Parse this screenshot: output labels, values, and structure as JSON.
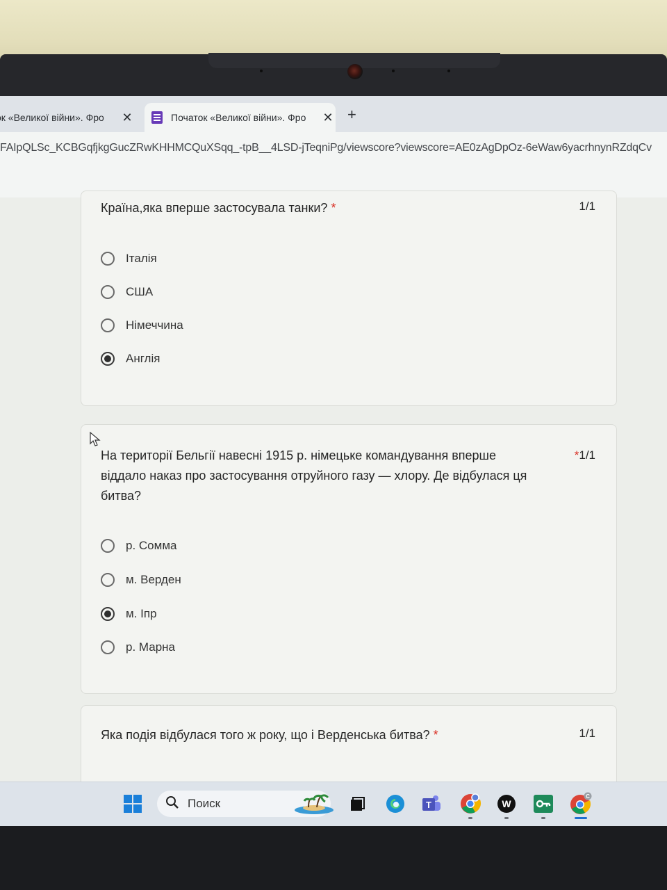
{
  "browser": {
    "tabs": [
      {
        "title": "ок «Великої війни». Фро",
        "active": false
      },
      {
        "title": "Початок «Великої війни». Фро",
        "active": true
      }
    ],
    "close_glyph": "✕",
    "new_tab_glyph": "+",
    "url": "FAIpQLSc_KCBGqfjkgGucZRwKHHMCQuXSqq_-tpB__4LSD-jTeqniPg/viewscore?viewscore=AE0zAgDpOz-6eWaw6yacrhnynRZdqCv"
  },
  "form": {
    "questions": [
      {
        "text": "Країна,яка вперше застосувала танки?",
        "required_mark": "*",
        "score": "1/1",
        "options": [
          {
            "label": "Італія",
            "selected": false
          },
          {
            "label": "США",
            "selected": false
          },
          {
            "label": "Німеччина",
            "selected": false
          },
          {
            "label": "Англія",
            "selected": true
          }
        ]
      },
      {
        "text_lines": [
          "На території Бельгії навесні 1915 р. німецьке командування вперше",
          "віддало наказ про застосування отруйного газу — хлору. Де відбулася ця",
          "битва?"
        ],
        "required_mark": "*",
        "score": "1/1",
        "options": [
          {
            "label": "р. Сомма",
            "selected": false
          },
          {
            "label": "м. Верден",
            "selected": false
          },
          {
            "label": "м. Іпр",
            "selected": true
          },
          {
            "label": "р. Марна",
            "selected": false
          }
        ]
      },
      {
        "text": "Яка подія відбулася того ж року, що і Верденська битва?",
        "required_mark": "*",
        "score": "1/1"
      }
    ]
  },
  "taskbar": {
    "search_placeholder": "Поиск",
    "icons": [
      "windows-start-icon",
      "search-icon",
      "widgets-icon",
      "task-view-icon",
      "edge-icon",
      "teams-icon",
      "chrome-profile-icon",
      "w-app-icon",
      "key-app-icon",
      "chrome-icon"
    ],
    "w_app_letter": "W",
    "chrome_badge": "C"
  },
  "colors": {
    "accent": "#673ab7",
    "required": "#d93025",
    "taskbar_active": "#1e6fd0"
  }
}
